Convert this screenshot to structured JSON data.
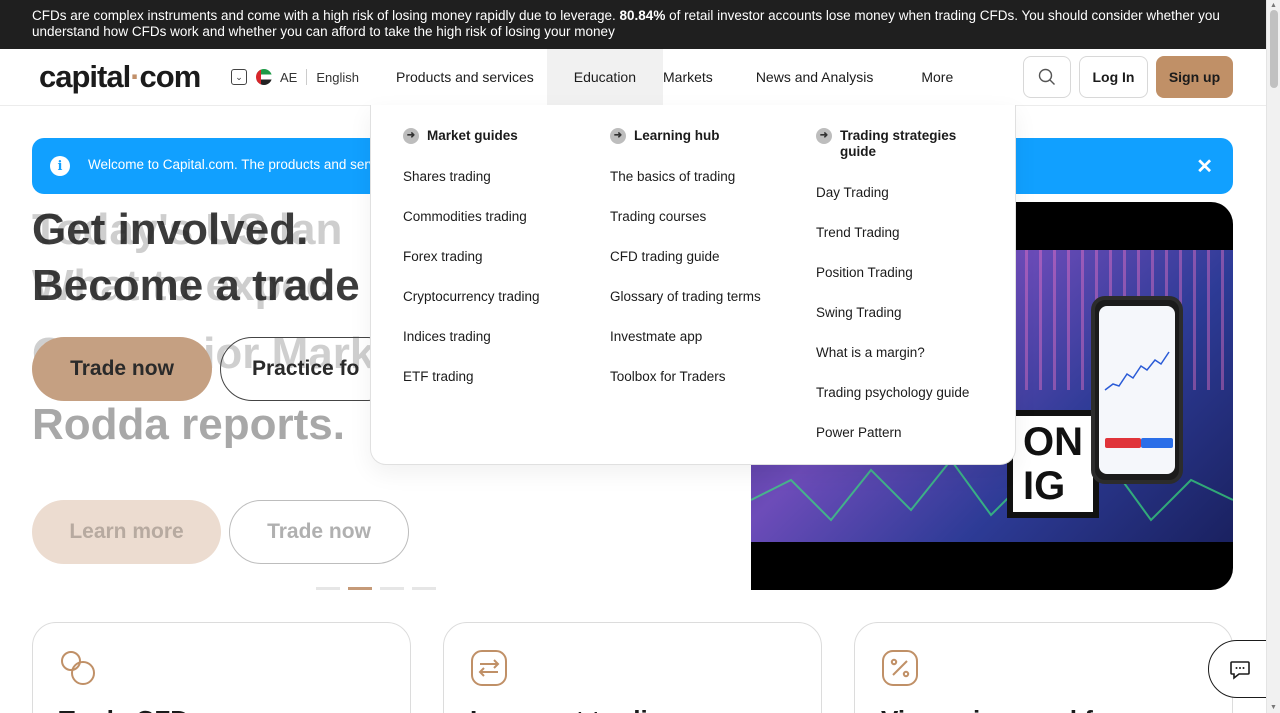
{
  "risk_banner": {
    "text_before": "CFDs are complex instruments and come with a high risk of losing money rapidly due to leverage. ",
    "percentage": "80.84%",
    "text_after": " of retail investor accounts lose money when trading CFDs. You should consider whether you understand how CFDs work and whether you can afford to take the high risk of losing your money"
  },
  "header": {
    "logo_part1": "capital",
    "logo_dot": "·",
    "logo_part2": "com",
    "region_code": "AE",
    "language": "English",
    "nav": [
      {
        "label": "Products and services"
      },
      {
        "label": "Education"
      },
      {
        "label": "Markets"
      },
      {
        "label": "News and Analysis"
      },
      {
        "label": "More"
      }
    ],
    "login_label": "Log In",
    "signup_label": "Sign up"
  },
  "welcome": {
    "text": "Welcome to Capital.com. The products and serv"
  },
  "hero": {
    "title_line1": "Get involved.",
    "title_line2": "Become a trade",
    "ghost_line1": "Today's US lan",
    "ghost_line2": "What to expec",
    "ghost_line3": "Our Senior Market",
    "ghost_line4": "Rodda reports.",
    "trade_now_label": "Trade now",
    "practice_label": "Practice fo",
    "learn_more_label": "Learn more",
    "trade_now2_label": "Trade now",
    "active_slide": 2,
    "slide_count": 4
  },
  "video": {
    "overlay_text_line1": "ON",
    "overlay_text_line2": "IG"
  },
  "education_menu": {
    "columns": [
      {
        "heading": "Market guides",
        "links": [
          "Shares trading",
          "Commodities trading",
          "Forex trading",
          "Cryptocurrency trading",
          "Indices trading",
          "ETF trading"
        ]
      },
      {
        "heading": "Learning hub",
        "links": [
          "The basics of trading",
          "Trading courses",
          "CFD trading guide",
          "Glossary of trading terms",
          "Investmate app",
          "Toolbox for Traders"
        ]
      },
      {
        "heading": "Trading strategies guide",
        "heading_line1": "Trading strategies",
        "heading_line2": "guide",
        "links": [
          "Day Trading",
          "Trend Trading",
          "Position Trading",
          "Swing Trading",
          "What is a margin?",
          "Trading psychology guide",
          "Power Pattern"
        ]
      }
    ]
  },
  "cards": [
    {
      "title": "Trade CFDs",
      "icon": "coins-icon"
    },
    {
      "title": "Low-cost trading",
      "icon": "exchange-icon"
    },
    {
      "title": "View prices and fees",
      "icon": "percent-icon"
    }
  ],
  "colors": {
    "brand": "#c09067",
    "info": "#11a0ff",
    "dark": "#1f1f1f"
  }
}
